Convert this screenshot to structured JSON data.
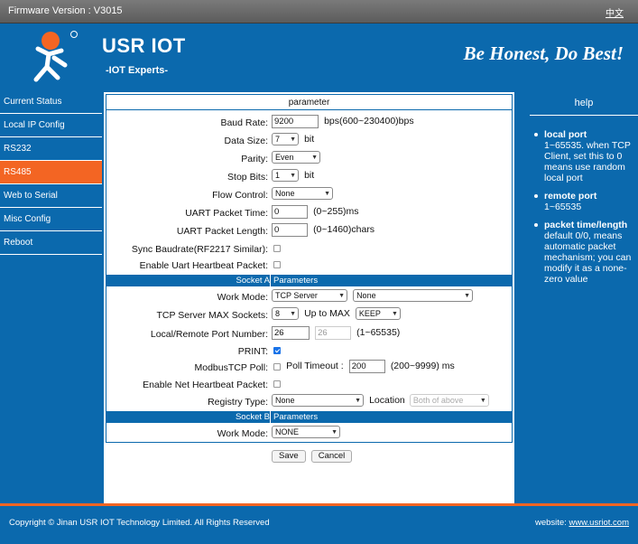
{
  "topbar": {
    "firmware": "Firmware Version : V3015",
    "lang": "中文"
  },
  "header": {
    "brand": "USR IOT",
    "subtitle": "-IOT Experts-",
    "slogan": "Be Honest, Do Best!"
  },
  "nav": [
    "Current Status",
    "Local IP Config",
    "RS232",
    "RS485",
    "Web to Serial",
    "Misc Config",
    "Reboot"
  ],
  "nav_active": "RS485",
  "panel": {
    "title": "parameter"
  },
  "form": {
    "baud_rate": {
      "label": "Baud Rate:",
      "value": "9200",
      "hint": "bps(600~230400)bps"
    },
    "data_size": {
      "label": "Data Size:",
      "value": "7",
      "unit": "bit"
    },
    "parity": {
      "label": "Parity:",
      "value": "Even"
    },
    "stop_bits": {
      "label": "Stop Bits:",
      "value": "1",
      "unit": "bit"
    },
    "flow_control": {
      "label": "Flow Control:",
      "value": "None"
    },
    "uart_time": {
      "label": "UART Packet Time:",
      "value": "0",
      "hint": "(0~255)ms"
    },
    "uart_length": {
      "label": "UART Packet Length:",
      "value": "0",
      "hint": "(0~1460)chars"
    },
    "sync_baud": {
      "label": "Sync Baudrate(RF2217 Similar):",
      "checked": false
    },
    "uart_heartbeat": {
      "label": "Enable Uart Heartbeat Packet:",
      "checked": false
    }
  },
  "socket_a": {
    "title_left": "Socket A",
    "title_right": "Parameters",
    "work_mode": {
      "label": "Work Mode:",
      "value": "TCP Server",
      "value2": "None"
    },
    "max_sockets": {
      "label": "TCP Server MAX Sockets:",
      "value": "8",
      "text": "Up to MAX",
      "keep": "KEEP"
    },
    "port": {
      "label": "Local/Remote Port Number:",
      "local": "26",
      "remote": "26",
      "hint": "(1~65535)"
    },
    "print": {
      "label": "PRINT:",
      "checked": true
    },
    "modbus": {
      "label": "ModbusTCP Poll:",
      "checked": false,
      "timeout_label": "Poll Timeout :",
      "timeout": "200",
      "hint": "(200~9999) ms"
    },
    "net_heartbeat": {
      "label": "Enable Net Heartbeat Packet:",
      "checked": false
    },
    "registry": {
      "label": "Registry Type:",
      "value": "None",
      "location_label": "Location",
      "location": "Both of above"
    }
  },
  "socket_b": {
    "title_left": "Socket B",
    "title_right": "Parameters",
    "work_mode": {
      "label": "Work Mode:",
      "value": "NONE"
    }
  },
  "buttons": {
    "save": "Save",
    "cancel": "Cancel"
  },
  "help": {
    "title": "help",
    "items": [
      {
        "title": "local port",
        "text": "1~65535. when TCP Client, set this to 0 means use random local port"
      },
      {
        "title": "remote port",
        "text": "1~65535"
      },
      {
        "title": "packet time/length",
        "text": "default 0/0, means automatic packet mechanism; you can modify it as a none-zero value"
      }
    ]
  },
  "footer": {
    "copyright": "Copyright © Jinan USR IOT Technology Limited. All Rights Reserved",
    "website_label": "website:",
    "website": "www.usriot.com"
  },
  "colors": {
    "primary": "#0b69ad",
    "accent": "#f36523"
  }
}
